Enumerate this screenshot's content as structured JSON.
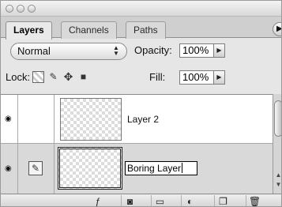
{
  "tabs": [
    {
      "label": "Layers",
      "active": true
    },
    {
      "label": "Channels",
      "active": false
    },
    {
      "label": "Paths",
      "active": false
    }
  ],
  "blend_mode": {
    "selected": "Normal"
  },
  "opacity": {
    "label": "Opacity:",
    "value": "100%"
  },
  "lock": {
    "label": "Lock:"
  },
  "fill": {
    "label": "Fill:",
    "value": "100%"
  },
  "layers": [
    {
      "name": "Layer 2",
      "visible": true,
      "selected": false
    },
    {
      "name": "Boring Layer",
      "visible": true,
      "selected": true,
      "editing": true
    }
  ],
  "icons": {
    "eye": "eye-icon",
    "brush": "paintbrush-icon",
    "lock_transparency": "lock-transparent-pixels-icon",
    "lock_paint": "lock-image-pixels-icon",
    "lock_position": "lock-position-icon",
    "lock_all": "lock-all-icon",
    "toolbar": [
      "layer-style-icon",
      "layer-mask-icon",
      "new-group-icon",
      "adjustment-layer-icon",
      "new-layer-icon",
      "trash-icon"
    ]
  },
  "colors": {
    "panel_bg": "#e6e6e6",
    "selected_row": "#d9d9d9"
  }
}
